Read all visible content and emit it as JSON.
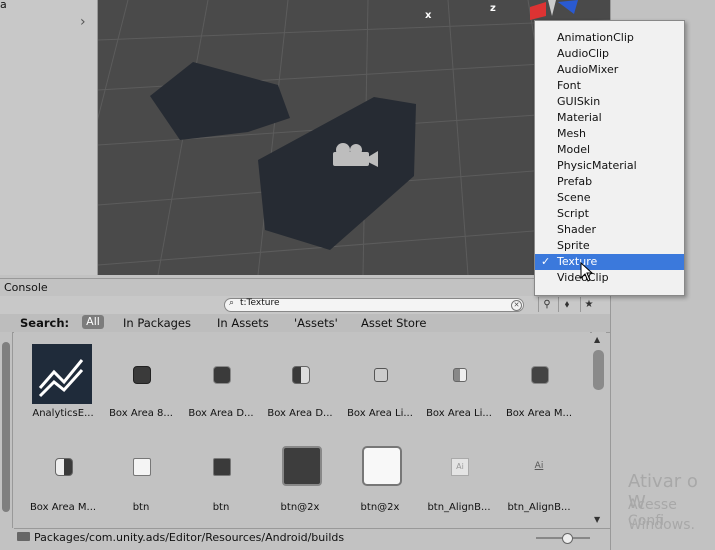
{
  "left_panel": {
    "label": "a"
  },
  "scene": {
    "axis_x": "x",
    "axis_z": "z"
  },
  "console": {
    "title": "Console"
  },
  "search": {
    "value": "t:Texture"
  },
  "scope": {
    "label": "Search:",
    "all": "All",
    "in_packages": "In Packages",
    "in_assets": "In Assets",
    "assets_folder": "'Assets'",
    "asset_store": "Asset Store"
  },
  "assets": [
    {
      "name": "AnalyticsE..."
    },
    {
      "name": "Box Area 8..."
    },
    {
      "name": "Box Area D..."
    },
    {
      "name": "Box Area D..."
    },
    {
      "name": "Box Area Li..."
    },
    {
      "name": "Box Area Li..."
    },
    {
      "name": "Box Area M..."
    },
    {
      "name": "Box Area M..."
    },
    {
      "name": "btn"
    },
    {
      "name": "btn"
    },
    {
      "name": "btn@2x"
    },
    {
      "name": "btn@2x"
    },
    {
      "name": "btn_AlignB..."
    },
    {
      "name": "btn_AlignB..."
    }
  ],
  "status": {
    "path": "Packages/com.unity.ads/Editor/Resources/Android/builds"
  },
  "dropdown": {
    "items": [
      "AnimationClip",
      "AudioClip",
      "AudioMixer",
      "Font",
      "GUISkin",
      "Material",
      "Mesh",
      "Model",
      "PhysicMaterial",
      "Prefab",
      "Scene",
      "Script",
      "Shader",
      "Sprite",
      "Texture",
      "VideoClip"
    ],
    "selected": "Texture",
    "check": "✓"
  },
  "watermark": {
    "line1": "Ativar o W",
    "line2": "Acesse Confi",
    "line3": "Windows."
  },
  "colors": {
    "selection": "#3b79dc",
    "scene_bg": "#4a4a4a"
  }
}
